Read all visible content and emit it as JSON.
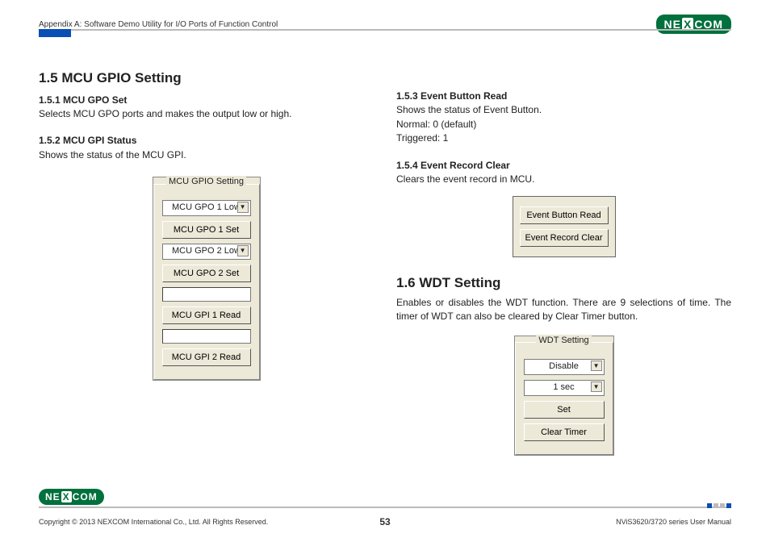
{
  "header": {
    "appendix_text": "Appendix A: Software Demo Utility for I/O Ports of Function Control",
    "logo_text_pre": "NE",
    "logo_text_x": "X",
    "logo_text_post": "COM"
  },
  "left": {
    "h1": "1.5  MCU GPIO Setting",
    "s1_heading": "1.5.1  MCU GPO Set",
    "s1_body": "Selects MCU GPO ports and makes the output low or high.",
    "s2_heading": "1.5.2  MCU GPI Status",
    "s2_body": "Shows the status of the MCU GPI.",
    "gpio_panel": {
      "legend": "MCU GPIO Setting",
      "gpo1_select": "MCU GPO 1 Low",
      "gpo1_set_btn": "MCU GPO 1 Set",
      "gpo2_select": "MCU GPO 2 Low",
      "gpo2_set_btn": "MCU GPO 2 Set",
      "gpi1_btn": "MCU GPI 1 Read",
      "gpi2_btn": "MCU GPI 2 Read"
    }
  },
  "right": {
    "s3_heading": "1.5.3  Event Button Read",
    "s3_body_l1": "Shows the status of Event Button.",
    "s3_body_l2": "Normal: 0 (default)",
    "s3_body_l3": "Triggered: 1",
    "s4_heading": "1.5.4  Event Record Clear",
    "s4_body": "Clears the event record in MCU.",
    "event_panel": {
      "btn_read": "Event Button Read",
      "btn_clear": "Event Record Clear"
    },
    "h1_wdt": "1.6  WDT Setting",
    "wdt_body": "Enables or disables the WDT function. There are 9 selections of time. The timer of WDT can also be cleared by Clear Timer button.",
    "wdt_panel": {
      "legend": "WDT Setting",
      "enable_select": "Disable",
      "time_select": "1 sec",
      "set_btn": "Set",
      "clear_btn": "Clear Timer"
    }
  },
  "footer": {
    "copyright": "Copyright © 2013 NEXCOM International Co., Ltd. All Rights Reserved.",
    "page_number": "53",
    "manual_ref": "NViS3620/3720 series User Manual"
  }
}
